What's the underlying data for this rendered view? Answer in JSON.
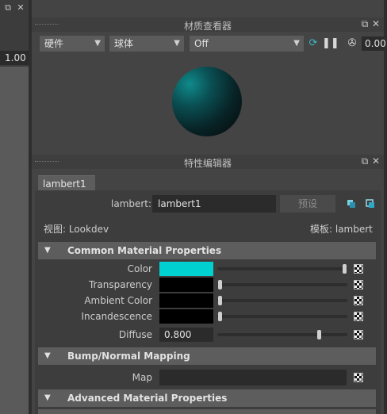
{
  "left": {
    "number_value": "1.00"
  },
  "hypershade": {
    "title": "材质查看器",
    "renderer": "硬件",
    "shape": "球体",
    "env": "Off",
    "exposure": "0.00"
  },
  "attr_editor": {
    "title": "特性编辑器",
    "tab": "lambert1",
    "type_label": "lambert:",
    "name": "lambert1",
    "preset_label": "预设",
    "view_label": "视图: Lookdev",
    "template_label": "模板: lambert"
  },
  "sections": {
    "common": "Common Material Properties",
    "bump": "Bump/Normal Mapping",
    "advanced": "Advanced Material Properties"
  },
  "attrs": {
    "color": {
      "label": "Color",
      "swatch": "#00d0d0",
      "slider": 1.0
    },
    "transparency": {
      "label": "Transparency",
      "swatch": "#000000",
      "slider": 0.0
    },
    "ambient": {
      "label": "Ambient Color",
      "swatch": "#000000",
      "slider": 0.0
    },
    "incandescence": {
      "label": "Incandescence",
      "swatch": "#000000",
      "slider": 0.0
    },
    "diffuse": {
      "label": "Diffuse",
      "value": "0.800",
      "slider": 0.8
    },
    "map": {
      "label": "Map"
    }
  },
  "colors": {
    "accent_cyan": "#00d0d0",
    "panel_bg": "#444444"
  },
  "icons": [
    "window-float-icon",
    "close-icon",
    "refresh-render-icon",
    "pause-icon",
    "exposure-icon",
    "node-select-icon",
    "node-copy-icon",
    "checker-map-icon"
  ]
}
